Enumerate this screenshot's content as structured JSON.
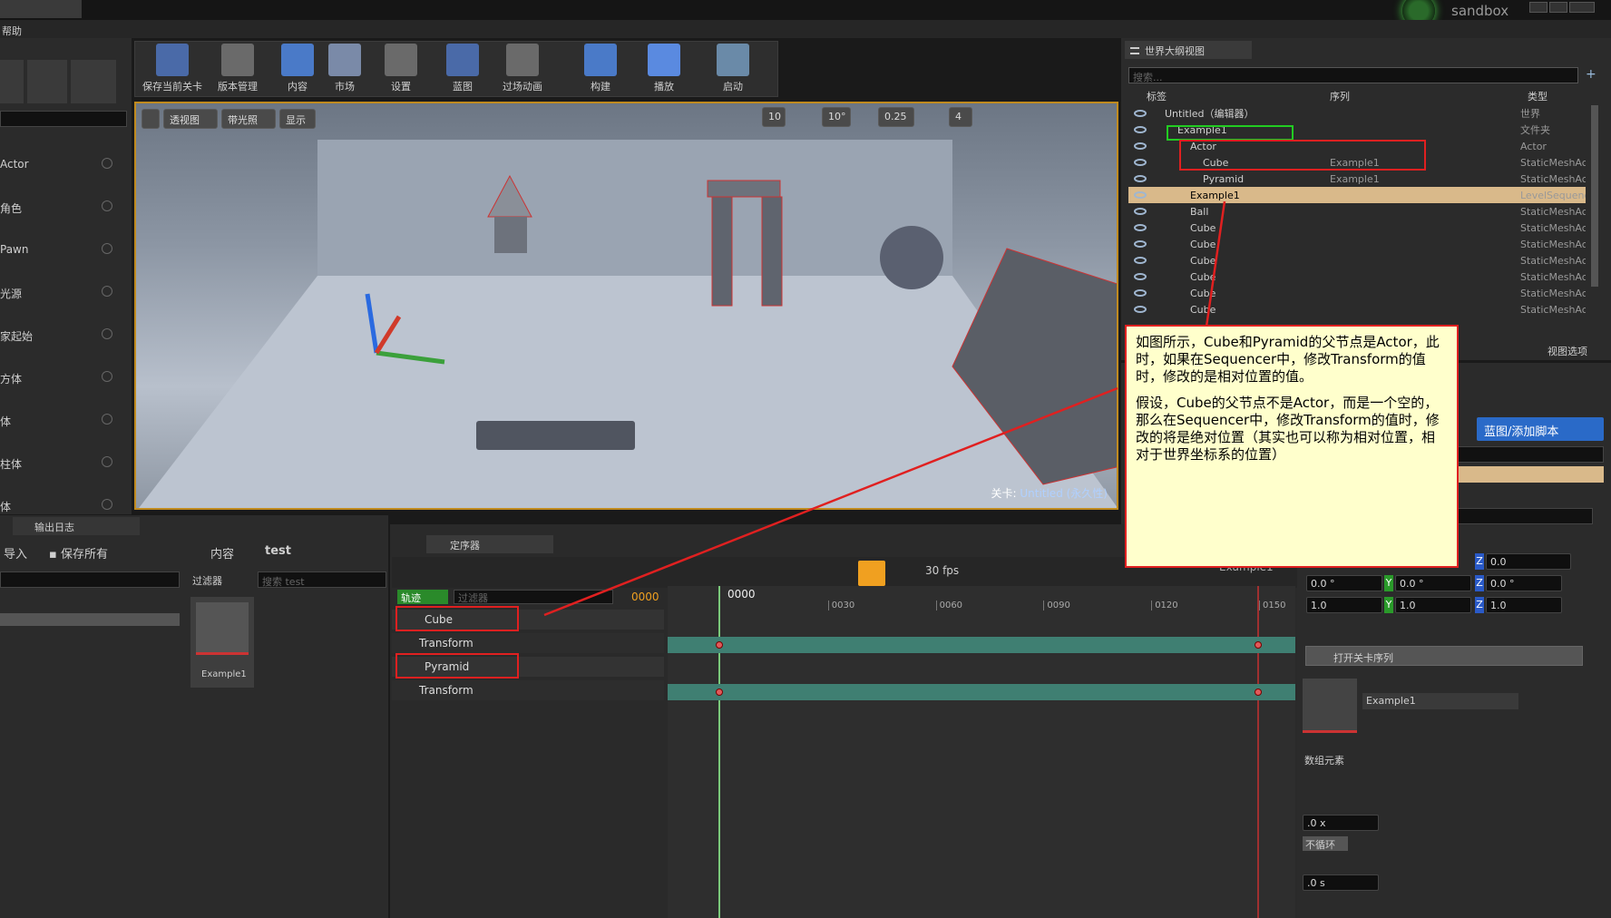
{
  "window": {
    "project": "sandbox",
    "menu_help": "帮助"
  },
  "toolbar": {
    "items": [
      {
        "label": "保存当前关卡",
        "icon": "save-icon"
      },
      {
        "label": "版本管理",
        "icon": "source-control-icon"
      },
      {
        "label": "内容",
        "icon": "content-icon"
      },
      {
        "label": "市场",
        "icon": "marketplace-icon"
      },
      {
        "label": "设置",
        "icon": "settings-icon"
      },
      {
        "label": "蓝图",
        "icon": "blueprint-icon"
      },
      {
        "label": "过场动画",
        "icon": "cinematics-icon"
      },
      {
        "label": "构建",
        "icon": "build-icon"
      },
      {
        "label": "播放",
        "icon": "play-icon"
      },
      {
        "label": "启动",
        "icon": "launch-icon"
      }
    ]
  },
  "place_panel": {
    "items": [
      "Actor",
      "角色",
      "Pawn",
      "光源",
      "家起始",
      "方体",
      "体",
      "柱体",
      "体"
    ]
  },
  "viewport": {
    "perspective": "透视图",
    "lit": "带光照",
    "show": "显示",
    "grid_snap": "10",
    "rot_snap": "10°",
    "scale_snap": "0.25",
    "cam_speed": "4",
    "level_label": "关卡:",
    "level_name": "Untitled (永久性)"
  },
  "outliner": {
    "tab": "世界大纲视图",
    "search_placeholder": "搜索...",
    "col_label": "标签",
    "col_seq": "序列",
    "col_type": "类型",
    "rows": [
      {
        "label": "Untitled（编辑器）",
        "seq": "",
        "type": "世界",
        "indent": 0
      },
      {
        "label": "Example1",
        "seq": "",
        "type": "文件夹",
        "indent": 1
      },
      {
        "label": "Actor",
        "seq": "",
        "type": "Actor",
        "indent": 2
      },
      {
        "label": "Cube",
        "seq": "Example1",
        "type": "StaticMeshActo",
        "indent": 3
      },
      {
        "label": "Pyramid",
        "seq": "Example1",
        "type": "StaticMeshActo",
        "indent": 3
      },
      {
        "label": "Example1",
        "seq": "",
        "type": "LevelSequence",
        "indent": 2
      },
      {
        "label": "Ball",
        "seq": "",
        "type": "StaticMeshActo",
        "indent": 2
      },
      {
        "label": "Cube",
        "seq": "",
        "type": "StaticMeshActo",
        "indent": 2
      },
      {
        "label": "Cube",
        "seq": "",
        "type": "StaticMeshActo",
        "indent": 2
      },
      {
        "label": "Cube",
        "seq": "",
        "type": "StaticMeshActo",
        "indent": 2
      },
      {
        "label": "Cube",
        "seq": "",
        "type": "StaticMeshActo",
        "indent": 2
      },
      {
        "label": "Cube",
        "seq": "",
        "type": "StaticMeshActo",
        "indent": 2
      },
      {
        "label": "Cube",
        "seq": "",
        "type": "StaticMeshActo",
        "indent": 2
      },
      {
        "label": "",
        "seq": "",
        "type": "StaticMeshActo",
        "indent": 2
      }
    ],
    "view_options": "视图选项"
  },
  "annotation": {
    "p1": "如图所示，Cube和Pyramid的父节点是Actor，此时，如果在Sequencer中，修改Transform的值时，修改的是相对位置的值。",
    "p2": "假设，Cube的父节点不是Actor，而是一个空的，那么在Sequencer中，修改Transform的值时，修改的将是绝对位置（其实也可以称为相对位置，相对于世界坐标系的位置）"
  },
  "details": {
    "add_script": "蓝图/添加脚本",
    "row1": {
      "x": "",
      "y": "",
      "z": "0.0"
    },
    "row2": {
      "x": "0.0 °",
      "y": "0.0 °",
      "z": "0.0 °"
    },
    "row3": {
      "x": "1.0",
      "y": "1.0",
      "z": "1.0"
    },
    "open_level_seq": "打开关卡序列",
    "seq_asset": "Example1",
    "array_label": "数组元素",
    "rate": ".0 x",
    "loop": "不循环",
    "start": ".0 s"
  },
  "output_log": {
    "tab": "输出日志"
  },
  "content_browser": {
    "import": "导入",
    "save_all": "保存所有",
    "path_root": "内容",
    "path_folder": "test",
    "filters": "过滤器",
    "search_placeholder": "搜索 test",
    "asset_name": "Example1"
  },
  "sequencer": {
    "tab": "定序器",
    "fps": "30 fps",
    "track_btn": "轨迹",
    "filter_placeholder": "过滤器",
    "current_frame": "0000",
    "playhead_label": "0000",
    "ticks": [
      "0030",
      "0060",
      "0090",
      "0120",
      "0150"
    ],
    "tracks": [
      {
        "name": "Cube",
        "sub": "Transform"
      },
      {
        "name": "Pyramid",
        "sub": "Transform"
      }
    ],
    "end_label": "Example1"
  },
  "colors": {
    "accent": "#f0a020",
    "annotation_bg": "#ffffcc",
    "highlight_red": "#e02020",
    "highlight_green": "#22cc22",
    "selected_row": "#d9b98a",
    "keyband": "#3f7f72"
  }
}
